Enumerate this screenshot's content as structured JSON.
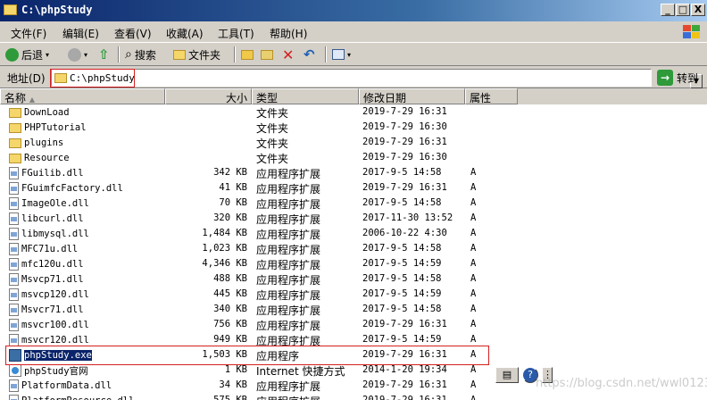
{
  "window": {
    "title": "C:\\phpStudy",
    "min": "_",
    "max": "□",
    "close": "X"
  },
  "menu": [
    "文件(F)",
    "编辑(E)",
    "查看(V)",
    "收藏(A)",
    "工具(T)",
    "帮助(H)"
  ],
  "toolbar": {
    "back": "后退",
    "search": "搜索",
    "folders": "文件夹"
  },
  "address": {
    "label": "地址(D)",
    "value": "C:\\phpStudy",
    "go": "转到"
  },
  "columns": {
    "name": "名称",
    "size": "大小",
    "type": "类型",
    "modified": "修改日期",
    "attr": "属性"
  },
  "files": [
    {
      "name": "DownLoad",
      "size": "",
      "type": "文件夹",
      "date": "2019-7-29 16:31",
      "attr": "",
      "icon": "folder-icon"
    },
    {
      "name": "PHPTutorial",
      "size": "",
      "type": "文件夹",
      "date": "2019-7-29 16:30",
      "attr": "",
      "icon": "folder-icon"
    },
    {
      "name": "plugins",
      "size": "",
      "type": "文件夹",
      "date": "2019-7-29 16:31",
      "attr": "",
      "icon": "folder-icon"
    },
    {
      "name": "Resource",
      "size": "",
      "type": "文件夹",
      "date": "2019-7-29 16:30",
      "attr": "",
      "icon": "folder-icon"
    },
    {
      "name": "FGuilib.dll",
      "size": "342 KB",
      "type": "应用程序扩展",
      "date": "2017-9-5 14:58",
      "attr": "A",
      "icon": "dll-icon"
    },
    {
      "name": "FGuimfcFactory.dll",
      "size": "41 KB",
      "type": "应用程序扩展",
      "date": "2019-7-29 16:31",
      "attr": "A",
      "icon": "dll-icon"
    },
    {
      "name": "ImageOle.dll",
      "size": "70 KB",
      "type": "应用程序扩展",
      "date": "2017-9-5 14:58",
      "attr": "A",
      "icon": "dll-icon"
    },
    {
      "name": "libcurl.dll",
      "size": "320 KB",
      "type": "应用程序扩展",
      "date": "2017-11-30 13:52",
      "attr": "A",
      "icon": "dll-icon"
    },
    {
      "name": "libmysql.dll",
      "size": "1,484 KB",
      "type": "应用程序扩展",
      "date": "2006-10-22 4:30",
      "attr": "A",
      "icon": "dll-icon"
    },
    {
      "name": "MFC71u.dll",
      "size": "1,023 KB",
      "type": "应用程序扩展",
      "date": "2017-9-5 14:58",
      "attr": "A",
      "icon": "dll-icon"
    },
    {
      "name": "mfc120u.dll",
      "size": "4,346 KB",
      "type": "应用程序扩展",
      "date": "2017-9-5 14:59",
      "attr": "A",
      "icon": "dll-icon"
    },
    {
      "name": "Msvcp71.dll",
      "size": "488 KB",
      "type": "应用程序扩展",
      "date": "2017-9-5 14:58",
      "attr": "A",
      "icon": "dll-icon"
    },
    {
      "name": "msvcp120.dll",
      "size": "445 KB",
      "type": "应用程序扩展",
      "date": "2017-9-5 14:59",
      "attr": "A",
      "icon": "dll-icon"
    },
    {
      "name": "Msvcr71.dll",
      "size": "340 KB",
      "type": "应用程序扩展",
      "date": "2017-9-5 14:58",
      "attr": "A",
      "icon": "dll-icon"
    },
    {
      "name": "msvcr100.dll",
      "size": "756 KB",
      "type": "应用程序扩展",
      "date": "2019-7-29 16:31",
      "attr": "A",
      "icon": "dll-icon"
    },
    {
      "name": "msvcr120.dll",
      "size": "949 KB",
      "type": "应用程序扩展",
      "date": "2017-9-5 14:59",
      "attr": "A",
      "icon": "dll-icon"
    },
    {
      "name": "phpStudy.exe",
      "size": "1,503 KB",
      "type": "应用程序",
      "date": "2019-7-29 16:31",
      "attr": "A",
      "icon": "exe-icon",
      "selected": true
    },
    {
      "name": "phpStudy官网",
      "size": "1 KB",
      "type": "Internet 快捷方式",
      "date": "2014-1-20 19:34",
      "attr": "A",
      "icon": "link-icon"
    },
    {
      "name": "PlatformData.dll",
      "size": "34 KB",
      "type": "应用程序扩展",
      "date": "2019-7-29 16:31",
      "attr": "A",
      "icon": "dll-icon"
    },
    {
      "name": "PlatformResource.dll",
      "size": "575 KB",
      "type": "应用程序扩展",
      "date": "2019-7-29 16:31",
      "attr": "A",
      "icon": "dll-icon"
    }
  ],
  "tray": {
    "help": "?"
  },
  "watermark": "https://blog.csdn.net/wwl012345"
}
